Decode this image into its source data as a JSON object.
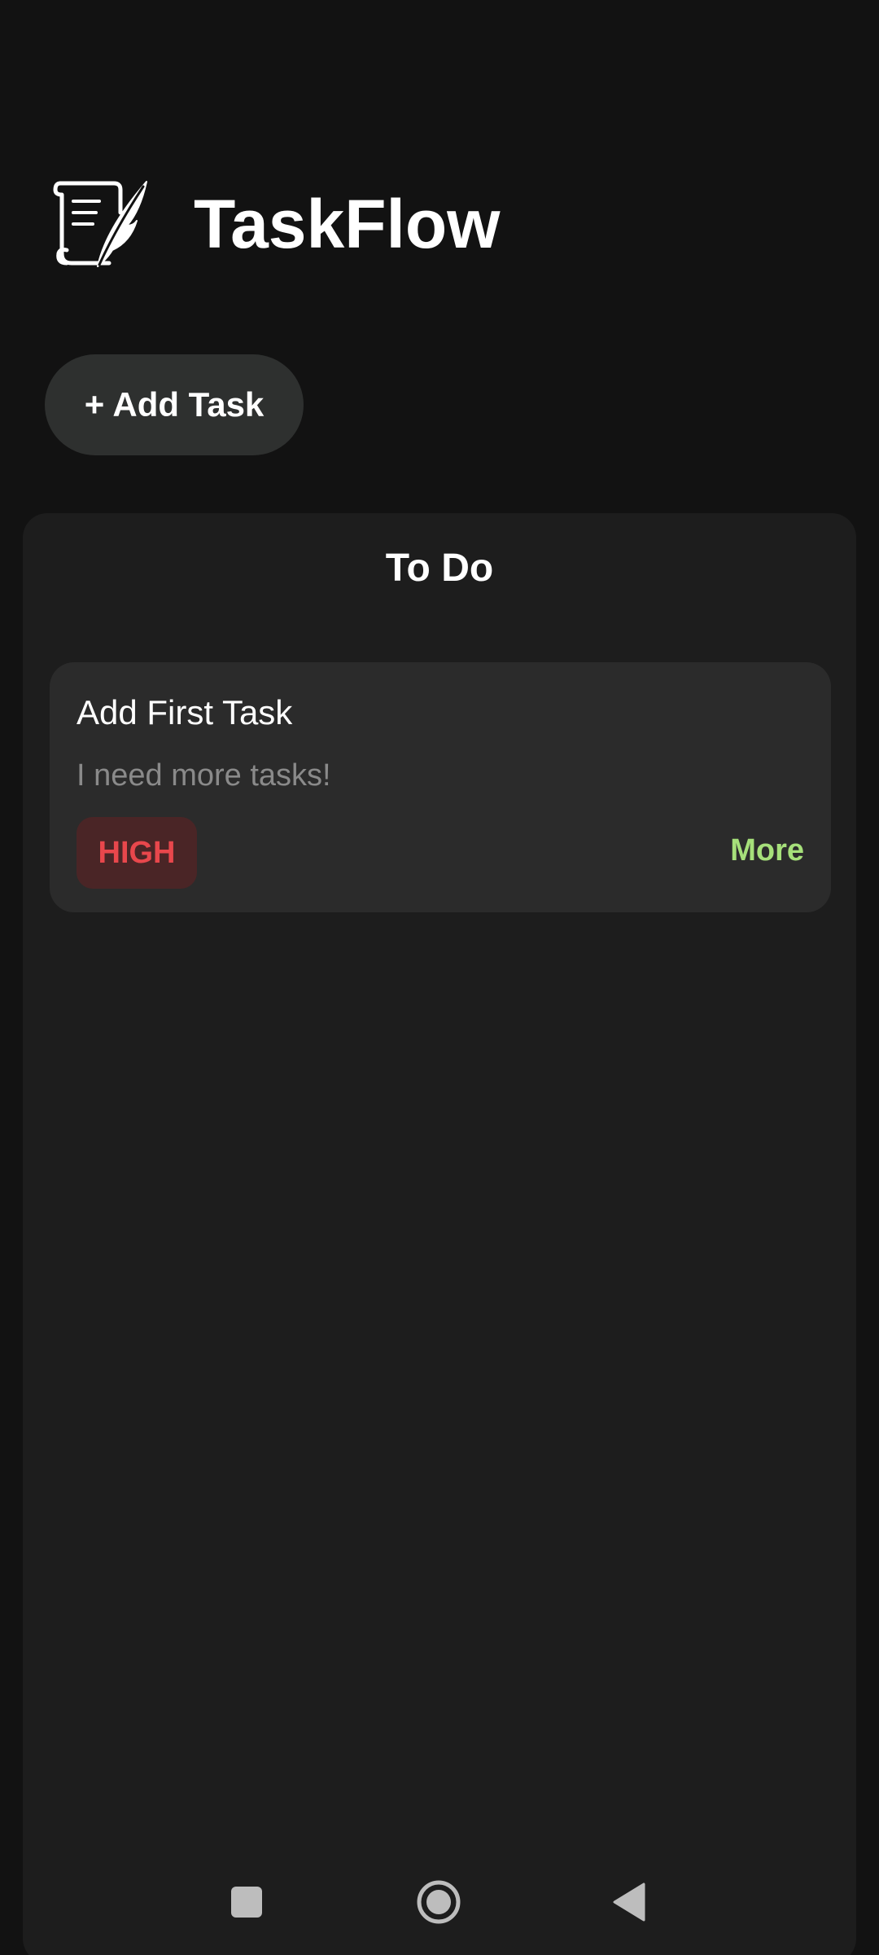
{
  "app": {
    "title": "TaskFlow",
    "logo_icon": "scroll-quill-icon"
  },
  "toolbar": {
    "add_task_label": "+ Add Task"
  },
  "column": {
    "title": "To Do",
    "tasks": [
      {
        "title": "Add First Task",
        "description": "I need more tasks!",
        "priority": "HIGH",
        "more_label": "More"
      }
    ]
  },
  "colors": {
    "background": "#121212",
    "panel": "#1d1d1d",
    "card": "#2b2b2b",
    "priority_high_text": "#e8474c",
    "priority_high_bg": "#4a2526",
    "accent_more": "#a6e07a"
  },
  "system_nav": {
    "buttons": [
      "recents-icon",
      "home-icon",
      "back-icon"
    ]
  }
}
